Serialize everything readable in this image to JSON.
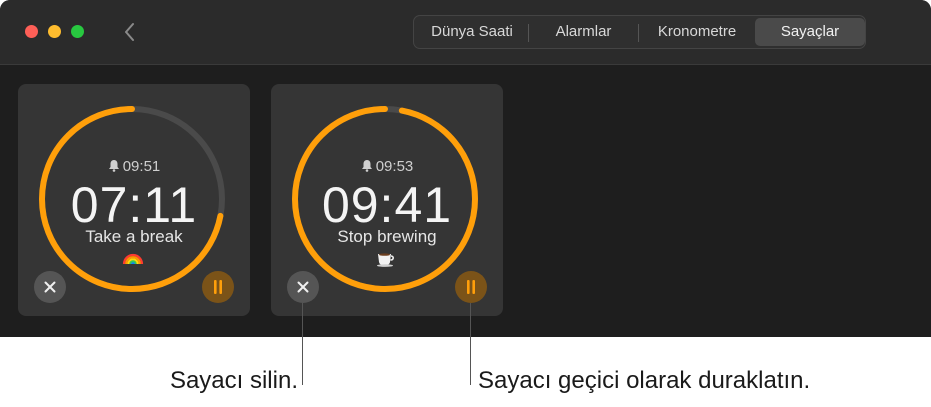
{
  "window": {
    "back_icon": "chevron-left-icon"
  },
  "tabs": [
    {
      "label": "Dünya Saati",
      "active": false
    },
    {
      "label": "Alarmlar",
      "active": false
    },
    {
      "label": "Kronometre",
      "active": false
    },
    {
      "label": "Sayaçlar",
      "active": true
    }
  ],
  "timers": [
    {
      "alarm_time": "09:51",
      "remaining": "07:11",
      "label": "Take a break",
      "emoji_icon": "rainbow-icon",
      "progress": 0.72
    },
    {
      "alarm_time": "09:53",
      "remaining": "09:41",
      "label": "Stop brewing",
      "emoji_icon": "coffee-cup-icon",
      "progress": 0.97
    }
  ],
  "callouts": {
    "delete": "Sayacı silin.",
    "pause": "Sayacı geçici olarak duraklatın."
  },
  "colors": {
    "accent": "#ff9f0a",
    "ring_track": "#4a4a4a",
    "card": "#353535",
    "window": "#1e1e1e"
  }
}
